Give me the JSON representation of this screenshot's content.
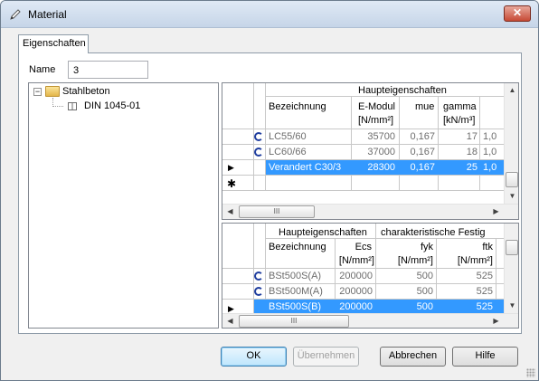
{
  "window": {
    "title": "Material",
    "close_glyph": "✕"
  },
  "tab": {
    "label": "Eigenschaften"
  },
  "name_field": {
    "label": "Name",
    "value": "3"
  },
  "tree": {
    "root": {
      "toggle": "−",
      "label": "Stahlbeton"
    },
    "child": {
      "label": "DIN 1045-01"
    }
  },
  "grid_top": {
    "group_header": "Haupteigenschaften",
    "col_name": "Bezeichnung",
    "col_e_line1": "E-Modul",
    "col_e_line2": "[N/mm²]",
    "col_mue": "mue",
    "col_gamma_line1": "gamma",
    "col_gamma_line2": "[kN/m³]",
    "rows": [
      {
        "name": "LC55/60",
        "e": "35700",
        "mue": "0,167",
        "gamma": "17",
        "extra": "1,0"
      },
      {
        "name": "LC60/66",
        "e": "37000",
        "mue": "0,167",
        "gamma": "18",
        "extra": "1,0"
      },
      {
        "marker": "▶",
        "name": "Verandert  C30/3",
        "e": "28300",
        "mue": "0,167",
        "gamma": "25",
        "extra": "1,0"
      }
    ],
    "new_row_marker": "✱",
    "hscroll_grip": "III"
  },
  "grid_bottom": {
    "group_header_1": "Haupteigenschaften",
    "group_header_2": "charakteristische Festig",
    "col_name": "Bezeichnung",
    "col_ecs": "Ecs",
    "col_fyk": "fyk",
    "col_ftk": "ftk",
    "unit": "[N/mm²]",
    "rows": [
      {
        "name": "BSt500S(A)",
        "ecs": "200000",
        "fyk": "500",
        "ftk": "525"
      },
      {
        "name": "BSt500M(A)",
        "ecs": "200000",
        "fyk": "500",
        "ftk": "525"
      },
      {
        "marker": "▶",
        "name": "BSt500S(B)",
        "ecs": "200000",
        "fyk": "500",
        "ftk": "525"
      }
    ],
    "hscroll_grip": "III"
  },
  "buttons": {
    "ok": "OK",
    "apply": "Übernehmen",
    "cancel": "Abbrechen",
    "help": "Hilfe"
  },
  "colors": {
    "selection": "#3399ff",
    "title_gradient_top": "#dfe9f5",
    "close": "#c74a35"
  },
  "icons": [
    "pencil-icon",
    "close-icon",
    "folder-icon",
    "table-icon",
    "reference-icon"
  ]
}
